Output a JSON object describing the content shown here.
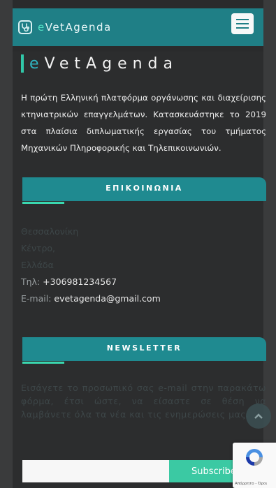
{
  "brand": {
    "prefix": "e",
    "name": "VetAgenda"
  },
  "hero": {
    "prefix": "e",
    "name": "VetAgenda"
  },
  "about": "Η πρώτη Ελληνική πλατφόρμα οργάνωσης και διαχείρισης κτηνιατρικών επαγγελμάτων. Κατασκευάστηκε το 2019 στα πλαίσια διπλωματικής εργασίας του τμήματος Μηχανικών Πληροφορικής και Τηλεπικοινωνιών.",
  "contact": {
    "title": "ΕΠΙΚΟΙΝΩΝΙΑ",
    "city": "Θεσσαλονίκη",
    "area": "Κέντρο,",
    "country": "Ελλάδα",
    "phone_label": "Τηλ:",
    "phone": "+306981234567",
    "email_label": "E-mail:",
    "email": "evetagenda@gmail.com"
  },
  "newsletter": {
    "title": "NEWSLETTER",
    "text": "Εισάγετε το προσωπικό σας e-mail στην παρακάτω φόρμα, έτσι ώστε, να είσαστε σε θέση να λαμβάνετε όλα τα νέα και τις ενημερώσεις μας.",
    "input_value": "",
    "button": "Subscribe"
  },
  "recaptcha": {
    "text": "Απόρρητο - Όροι"
  },
  "colors": {
    "nav": "#1f7f86",
    "accent": "#3bc9a3",
    "background": "#2c2d2e"
  },
  "icons": {
    "brand": "stethoscope-icon",
    "menu": "hamburger-icon",
    "scroll_top": "chevron-up-icon",
    "recaptcha": "recaptcha-icon"
  }
}
